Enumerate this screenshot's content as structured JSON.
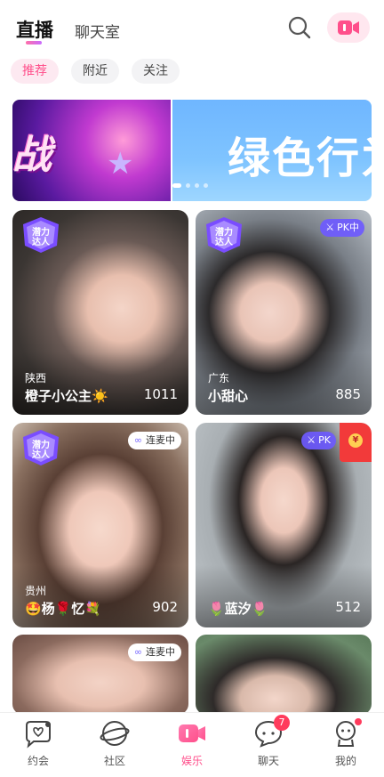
{
  "header": {
    "tab_live": "直播",
    "tab_chatroom": "聊天室",
    "search_icon": "search-icon",
    "live_icon": "video-camera-icon",
    "accent": "#ff4f8b"
  },
  "subtabs": [
    "推荐",
    "附近",
    "关注"
  ],
  "banner": {
    "left_text": "战",
    "right_text": "绿色行为"
  },
  "cards": [
    {
      "location": "陕西",
      "name": "橙子小公主☀️",
      "count": "1011",
      "badge": "潜力达人"
    },
    {
      "location": "广东",
      "name": "小甜心",
      "count": "885",
      "tag": "PK中"
    },
    {
      "location": "贵州",
      "name": "🤩杨🌹忆💐",
      "count": "902",
      "badge": "潜力达人",
      "tag": "连麦中"
    },
    {
      "location": "",
      "name": "🌷蓝汐🌷",
      "count": "512",
      "tag": "PK"
    },
    {
      "tag": "连麦中"
    },
    {}
  ],
  "bottom_nav": [
    {
      "label": "约会",
      "icon": "heart-chat-icon"
    },
    {
      "label": "社区",
      "icon": "planet-icon"
    },
    {
      "label": "娱乐",
      "icon": "video-icon"
    },
    {
      "label": "聊天",
      "icon": "chat-bubble-icon",
      "badge": "7"
    },
    {
      "label": "我的",
      "icon": "profile-icon"
    }
  ]
}
